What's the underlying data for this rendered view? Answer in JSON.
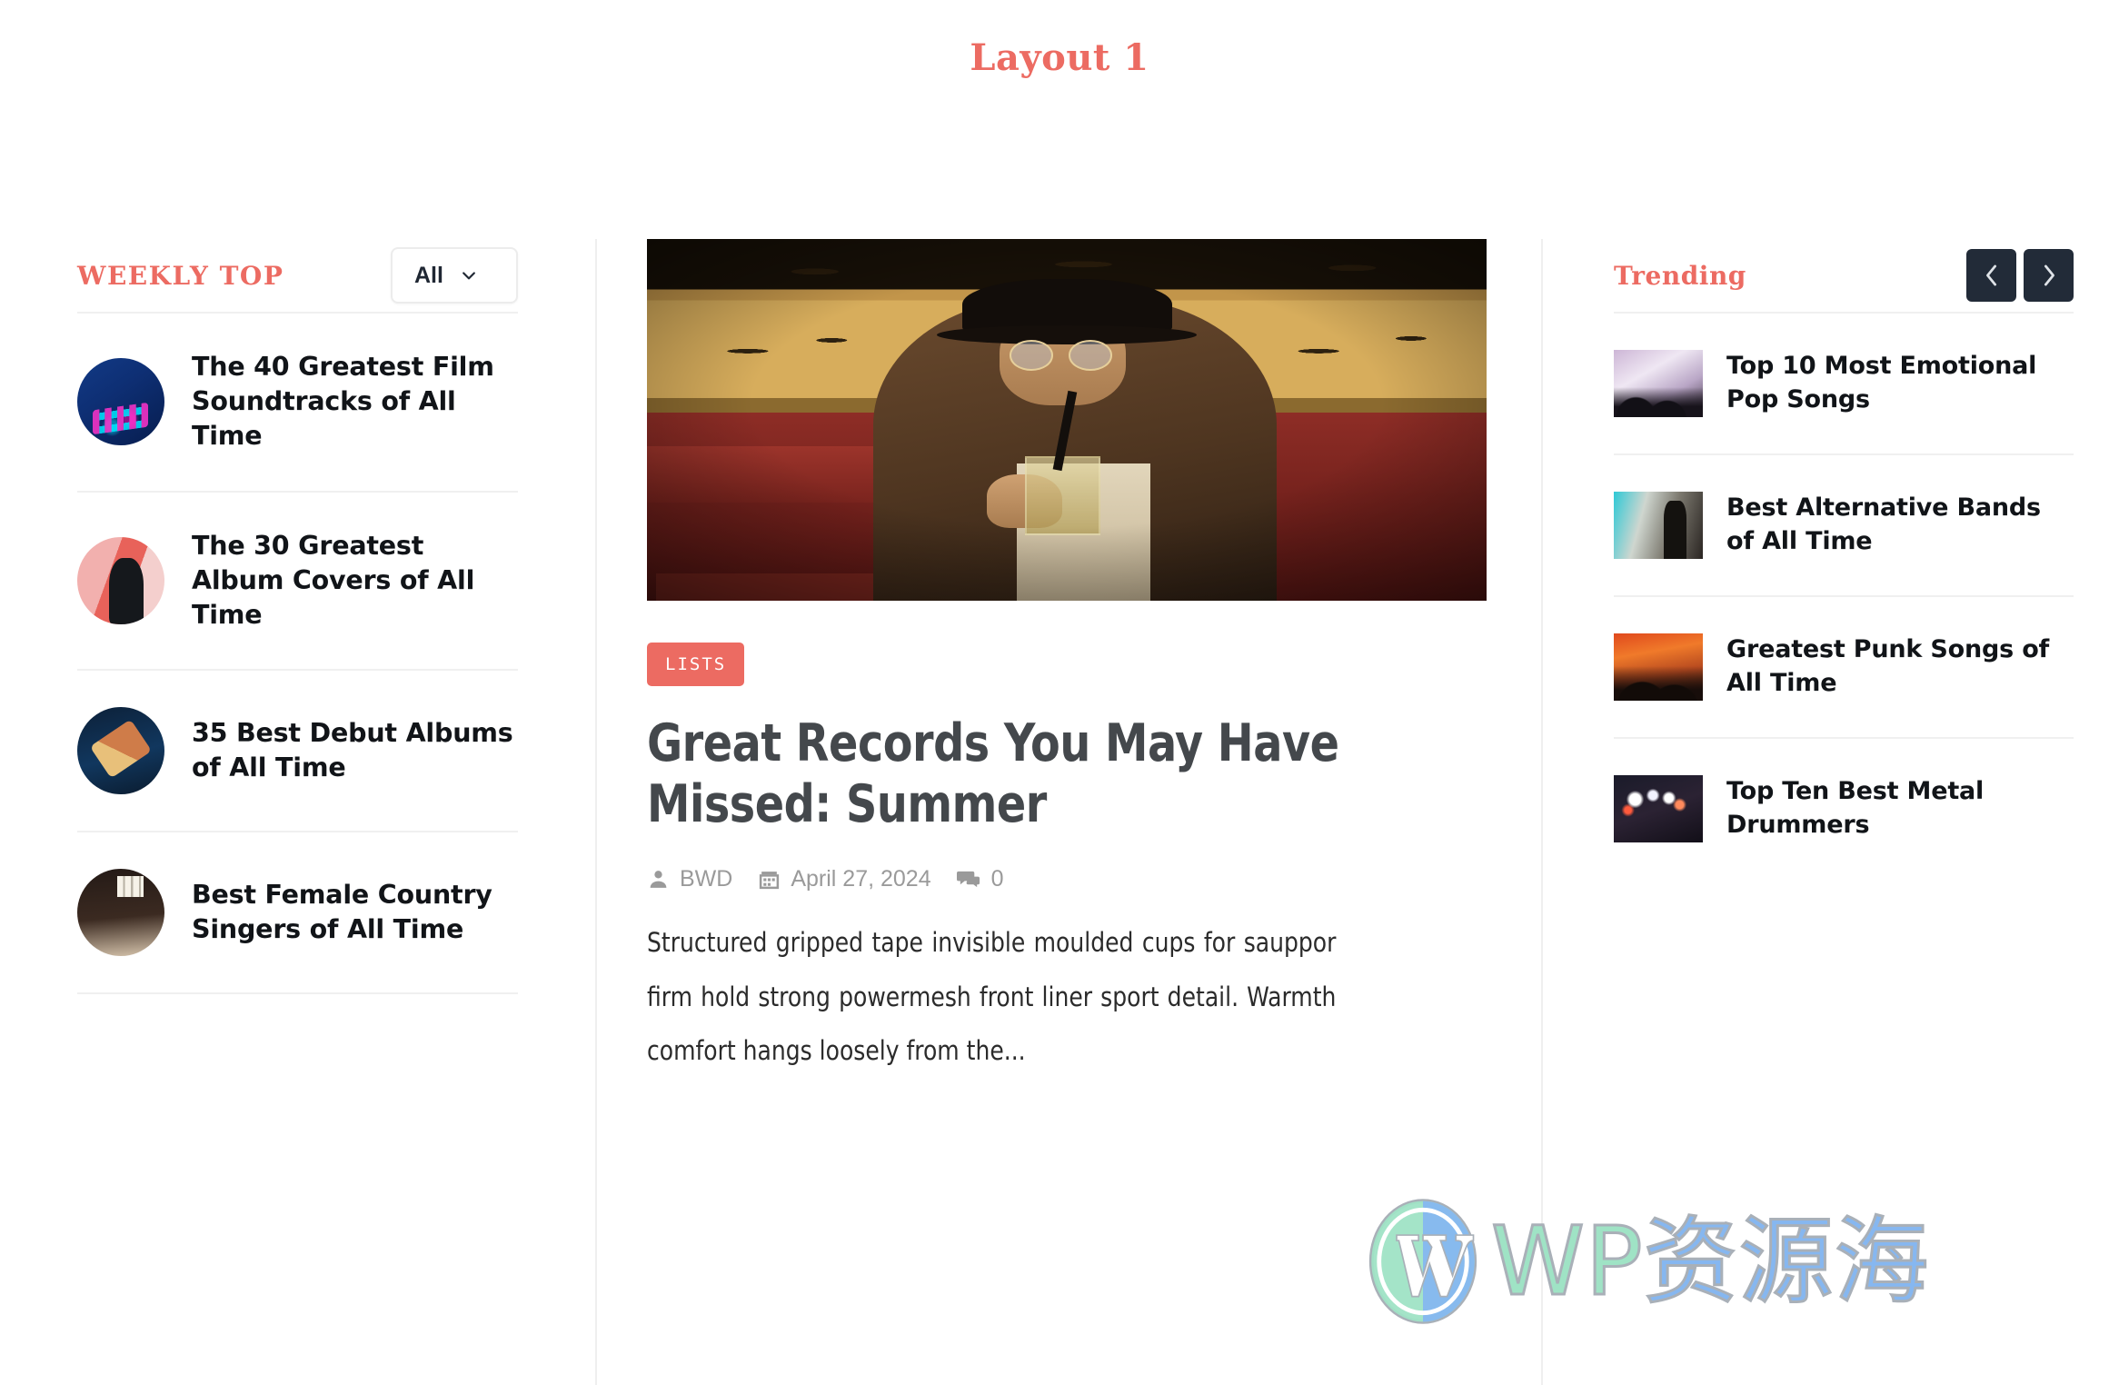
{
  "page": {
    "title": "Layout 1",
    "accent_color": "#ec6b62",
    "dark_color": "#222b38"
  },
  "weekly_top": {
    "heading": "WEEKLY TOP",
    "filter": {
      "selected": "All",
      "icon": "chevron-down-icon"
    },
    "items": [
      {
        "title": "The 40 Greatest Film Soundtracks of All Time",
        "thumb": "dj-controller-neon"
      },
      {
        "title": "The 30 Greatest Album Covers of All Time",
        "thumb": "singer-pink-backdrop"
      },
      {
        "title": "35 Best Debut Albums of All Time",
        "thumb": "guitarist-blue-stage"
      },
      {
        "title": "Best Female Country Singers of All Time",
        "thumb": "dark-studio-room"
      }
    ]
  },
  "article": {
    "hero_image_alt": "man-in-hat-with-round-glasses-drinking",
    "category": "LISTS",
    "title": "Great Records You May Have Missed: Summer",
    "meta": {
      "author_icon": "user-icon",
      "author": "BWD",
      "date_icon": "calendar-icon",
      "date": "April 27, 2024",
      "comments_icon": "comments-icon",
      "comments": "0"
    },
    "excerpt": "Structured gripped tape invisible moulded cups for sauppor firm hold strong powermesh front liner sport detail. Warmth comfort hangs loosely from the..."
  },
  "trending": {
    "heading": "Trending",
    "prev_icon": "chevron-left-icon",
    "next_icon": "chevron-right-icon",
    "items": [
      {
        "title": "Top 10 Most Emotional Pop Songs",
        "thumb": "crowd-smoke-lights"
      },
      {
        "title": "Best Alternative Bands of All Time",
        "thumb": "silhouette-mic-teal"
      },
      {
        "title": "Greatest Punk Songs of All Time",
        "thumb": "red-lit-crowd"
      },
      {
        "title": "Top Ten Best Metal Drummers",
        "thumb": "stage-lights-dark"
      }
    ]
  },
  "watermark": {
    "logo_icon": "wordpress-logo-icon",
    "text_latin": "WP",
    "text_cjk": "资源海"
  }
}
